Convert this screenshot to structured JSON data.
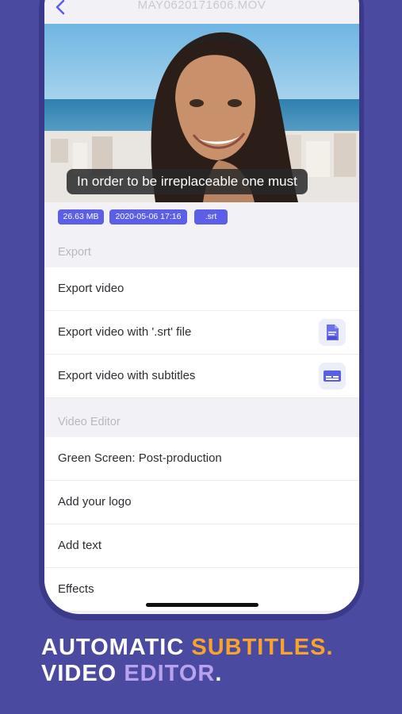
{
  "header": {
    "file_name": "MAY0620171606.MOV"
  },
  "video": {
    "subtitle": "In order to be irreplaceable one must"
  },
  "meta": {
    "size": "26.63 MB",
    "date": "2020-05-06 17:16",
    "format": ".srt"
  },
  "export": {
    "title": "Export",
    "items": [
      {
        "label": "Export video"
      },
      {
        "label": "Export video with '.srt' file",
        "icon": "srt-file-icon"
      },
      {
        "label": "Export video with subtitles",
        "icon": "subtitles-icon"
      }
    ]
  },
  "editor": {
    "title": "Video Editor",
    "items": [
      {
        "label": "Green Screen: Post-production"
      },
      {
        "label": "Add your logo"
      },
      {
        "label": "Add text"
      },
      {
        "label": "Effects"
      }
    ]
  },
  "tagline": {
    "line1_a": "AUTOMATIC ",
    "line1_b": "SUBTITLES",
    "line1_c": ".",
    "line2_a": "VIDEO ",
    "line2_b": "EDITOR",
    "line2_c": "."
  },
  "colors": {
    "background": "#4a4aa0",
    "accent": "#5b5ee6",
    "orange": "#f6a52a",
    "lavender": "#b9a3ee"
  }
}
